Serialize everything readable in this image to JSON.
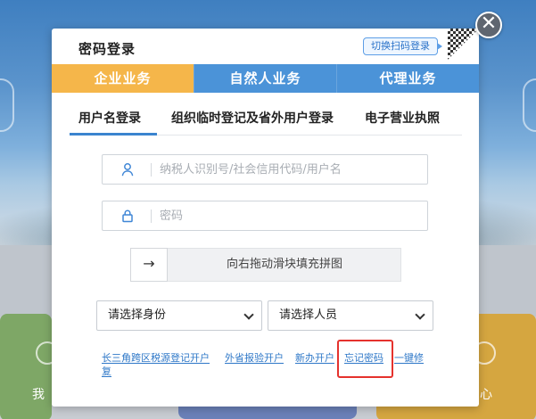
{
  "background": {
    "left_text": "我",
    "right_text": "心"
  },
  "modal": {
    "title": "密码登录",
    "switch_label": "切换扫码登录",
    "close_glyph": "✕",
    "business_tabs": [
      {
        "label": "企业业务",
        "active": true
      },
      {
        "label": "自然人业务",
        "active": false
      },
      {
        "label": "代理业务",
        "active": false
      }
    ],
    "login_tabs": [
      {
        "label": "用户名登录",
        "active": true
      },
      {
        "label": "组织临时登记及省外用户登录",
        "active": false
      },
      {
        "label": "电子营业执照",
        "active": false
      }
    ],
    "username": {
      "placeholder": "纳税人识别号/社会信用代码/用户名",
      "value": "",
      "icon": "user-icon"
    },
    "password": {
      "placeholder": "密码",
      "value": "",
      "icon": "lock-icon"
    },
    "slider": {
      "handle_glyph": "→",
      "text": "向右拖动滑块填充拼图"
    },
    "selects": [
      {
        "value": "请选择身份"
      },
      {
        "value": "请选择人员"
      }
    ],
    "links": [
      {
        "label": "长三角跨区税源登记开户"
      },
      {
        "label": "外省报验开户"
      },
      {
        "label": "新办开户"
      },
      {
        "label": "忘记密码"
      },
      {
        "label": "一键修"
      },
      {
        "label": "复"
      }
    ],
    "colors": {
      "active_tab": "#f5b64a",
      "inactive_tab": "#4b93d8",
      "link": "#2f78c8",
      "highlight": "#e5322d"
    }
  }
}
